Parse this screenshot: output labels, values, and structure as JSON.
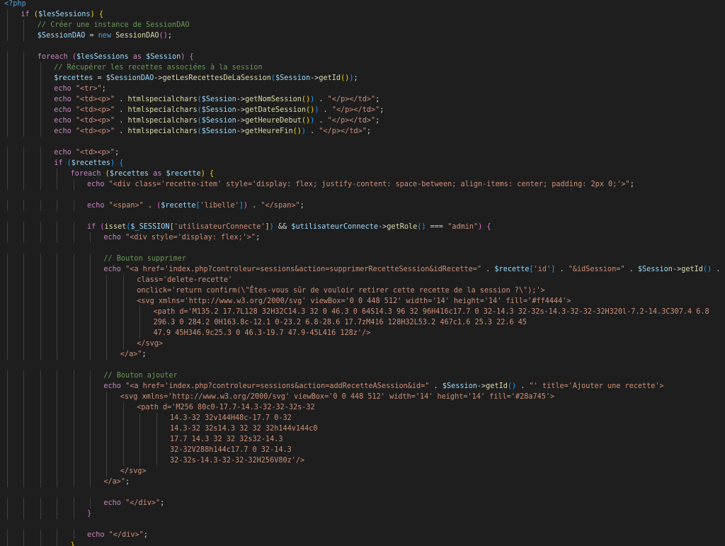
{
  "editor": {
    "language": "php",
    "lines": [
      {
        "indent": 0,
        "tokens": [
          [
            "php",
            "<?php"
          ]
        ]
      },
      {
        "indent": 1,
        "tokens": [
          [
            "kw",
            "if "
          ],
          [
            "b1",
            "("
          ],
          [
            "var",
            "$lesSessions"
          ],
          [
            "b1",
            ")"
          ],
          [
            "pn",
            " "
          ],
          [
            "b1",
            "{"
          ]
        ]
      },
      {
        "indent": 2,
        "tokens": [
          [
            "cm",
            "// Créer une instance de SessionDAO"
          ]
        ]
      },
      {
        "indent": 2,
        "tokens": [
          [
            "var",
            "$SessionDAO"
          ],
          [
            "pn",
            " = "
          ],
          [
            "st",
            "new "
          ],
          [
            "fn",
            "SessionDAO"
          ],
          [
            "b2",
            "()"
          ],
          [
            "pn",
            ";"
          ]
        ]
      },
      {
        "indent": 0,
        "tokens": []
      },
      {
        "indent": 2,
        "tokens": [
          [
            "kw",
            "foreach "
          ],
          [
            "b2",
            "("
          ],
          [
            "var",
            "$lesSessions"
          ],
          [
            "kw",
            " as "
          ],
          [
            "var",
            "$Session"
          ],
          [
            "b2",
            ")"
          ],
          [
            "pn",
            " "
          ],
          [
            "b2",
            "{"
          ]
        ]
      },
      {
        "indent": 3,
        "tokens": [
          [
            "cm",
            "// Récupérer les recettes associées à la session"
          ]
        ]
      },
      {
        "indent": 3,
        "tokens": [
          [
            "var",
            "$recettes"
          ],
          [
            "pn",
            " = "
          ],
          [
            "var",
            "$SessionDAO"
          ],
          [
            "pn",
            "->"
          ],
          [
            "fn",
            "getLesRecettesDeLaSession"
          ],
          [
            "b3",
            "("
          ],
          [
            "var",
            "$Session"
          ],
          [
            "pn",
            "->"
          ],
          [
            "fn",
            "getId"
          ],
          [
            "b1",
            "()"
          ],
          [
            "b3",
            ")"
          ],
          [
            "pn",
            ";"
          ]
        ]
      },
      {
        "indent": 3,
        "tokens": [
          [
            "kw",
            "echo "
          ],
          [
            "str",
            "\"<tr>\""
          ],
          [
            "pn",
            ";"
          ]
        ]
      },
      {
        "indent": 3,
        "tokens": [
          [
            "kw",
            "echo "
          ],
          [
            "str",
            "\"<td><p>\""
          ],
          [
            "pn",
            " . "
          ],
          [
            "fn",
            "htmlspecialchars"
          ],
          [
            "b3",
            "("
          ],
          [
            "var",
            "$Session"
          ],
          [
            "pn",
            "->"
          ],
          [
            "fn",
            "getNomSession"
          ],
          [
            "b1",
            "()"
          ],
          [
            "b3",
            ")"
          ],
          [
            "pn",
            " . "
          ],
          [
            "str",
            "\"</p></td>\""
          ],
          [
            "pn",
            ";"
          ]
        ]
      },
      {
        "indent": 3,
        "tokens": [
          [
            "kw",
            "echo "
          ],
          [
            "str",
            "\"<td><p>\""
          ],
          [
            "pn",
            " . "
          ],
          [
            "fn",
            "htmlspecialchars"
          ],
          [
            "b3",
            "("
          ],
          [
            "var",
            "$Session"
          ],
          [
            "pn",
            "->"
          ],
          [
            "fn",
            "getDateSession"
          ],
          [
            "b1",
            "()"
          ],
          [
            "b3",
            ")"
          ],
          [
            "pn",
            " . "
          ],
          [
            "str",
            "\"</p></td>\""
          ],
          [
            "pn",
            ";"
          ]
        ]
      },
      {
        "indent": 3,
        "tokens": [
          [
            "kw",
            "echo "
          ],
          [
            "str",
            "\"<td><p>\""
          ],
          [
            "pn",
            " . "
          ],
          [
            "fn",
            "htmlspecialchars"
          ],
          [
            "b3",
            "("
          ],
          [
            "var",
            "$Session"
          ],
          [
            "pn",
            "->"
          ],
          [
            "fn",
            "getHeureDebut"
          ],
          [
            "b1",
            "()"
          ],
          [
            "b3",
            ")"
          ],
          [
            "pn",
            " . "
          ],
          [
            "str",
            "\"</p></td>\""
          ],
          [
            "pn",
            ";"
          ]
        ]
      },
      {
        "indent": 3,
        "tokens": [
          [
            "kw",
            "echo "
          ],
          [
            "str",
            "\"<td><p>\""
          ],
          [
            "pn",
            " . "
          ],
          [
            "fn",
            "htmlspecialchars"
          ],
          [
            "b3",
            "("
          ],
          [
            "var",
            "$Session"
          ],
          [
            "pn",
            "->"
          ],
          [
            "fn",
            "getHeureFin"
          ],
          [
            "b1",
            "()"
          ],
          [
            "b3",
            ")"
          ],
          [
            "pn",
            " . "
          ],
          [
            "str",
            "\"</p></td>\""
          ],
          [
            "pn",
            ";"
          ]
        ]
      },
      {
        "indent": 0,
        "tokens": []
      },
      {
        "indent": 3,
        "tokens": [
          [
            "kw",
            "echo "
          ],
          [
            "str",
            "\"<td><p>\""
          ],
          [
            "pn",
            ";"
          ]
        ]
      },
      {
        "indent": 3,
        "tokens": [
          [
            "kw",
            "if "
          ],
          [
            "b3",
            "("
          ],
          [
            "var",
            "$recettes"
          ],
          [
            "b3",
            ")"
          ],
          [
            "pn",
            " "
          ],
          [
            "b3",
            "{"
          ]
        ]
      },
      {
        "indent": 4,
        "tokens": [
          [
            "kw",
            "foreach "
          ],
          [
            "b1",
            "("
          ],
          [
            "var",
            "$recettes"
          ],
          [
            "kw",
            " as "
          ],
          [
            "var",
            "$recette"
          ],
          [
            "b1",
            ")"
          ],
          [
            "pn",
            " "
          ],
          [
            "b1",
            "{"
          ]
        ]
      },
      {
        "indent": 5,
        "tokens": [
          [
            "kw",
            "echo "
          ],
          [
            "str",
            "\"<div class='recette-item' style='display: flex; justify-content: space-between; align-items: center; padding: 2px 0;'>\""
          ],
          [
            "pn",
            ";"
          ]
        ]
      },
      {
        "indent": 0,
        "tokens": []
      },
      {
        "indent": 5,
        "tokens": [
          [
            "kw",
            "echo "
          ],
          [
            "str",
            "\"<span>\""
          ],
          [
            "pn",
            " . "
          ],
          [
            "b2",
            "("
          ],
          [
            "var",
            "$recette"
          ],
          [
            "b3",
            "["
          ],
          [
            "str",
            "'libelle'"
          ],
          [
            "b3",
            "]"
          ],
          [
            "b2",
            ")"
          ],
          [
            "pn",
            " . "
          ],
          [
            "str",
            "\"</span>\""
          ],
          [
            "pn",
            ";"
          ]
        ]
      },
      {
        "indent": 0,
        "tokens": []
      },
      {
        "indent": 5,
        "tokens": [
          [
            "kw",
            "if "
          ],
          [
            "b2",
            "("
          ],
          [
            "fn",
            "isset"
          ],
          [
            "b3",
            "("
          ],
          [
            "var",
            "$_SESSION"
          ],
          [
            "b1",
            "["
          ],
          [
            "str",
            "'utilisateurConnecte'"
          ],
          [
            "b1",
            "]"
          ],
          [
            "b3",
            ")"
          ],
          [
            "pn",
            " && "
          ],
          [
            "var",
            "$utilisateurConnecte"
          ],
          [
            "pn",
            "->"
          ],
          [
            "fn",
            "getRole"
          ],
          [
            "b3",
            "()"
          ],
          [
            "pn",
            " === "
          ],
          [
            "str",
            "\"admin\""
          ],
          [
            "b2",
            ")"
          ],
          [
            "pn",
            " "
          ],
          [
            "b2",
            "{"
          ]
        ]
      },
      {
        "indent": 6,
        "tokens": [
          [
            "kw",
            "echo "
          ],
          [
            "str",
            "\"<div style='display: flex;'>\""
          ],
          [
            "pn",
            ";"
          ]
        ]
      },
      {
        "indent": 0,
        "tokens": []
      },
      {
        "indent": 6,
        "tokens": [
          [
            "cm",
            "// Bouton supprimer"
          ]
        ]
      },
      {
        "indent": 6,
        "tokens": [
          [
            "kw",
            "echo "
          ],
          [
            "str",
            "\"<a href='index.php?controleur=sessions&action=supprimerRecetteSession&idRecette=\""
          ],
          [
            "pn",
            " . "
          ],
          [
            "var",
            "$recette"
          ],
          [
            "b3",
            "["
          ],
          [
            "str",
            "'id'"
          ],
          [
            "b3",
            "]"
          ],
          [
            "pn",
            " . "
          ],
          [
            "str",
            "\"&idSession=\""
          ],
          [
            "pn",
            " . "
          ],
          [
            "var",
            "$Session"
          ],
          [
            "pn",
            "->"
          ],
          [
            "fn",
            "getId"
          ],
          [
            "b3",
            "()"
          ],
          [
            "pn",
            " . "
          ],
          [
            "str",
            "\"'"
          ]
        ]
      },
      {
        "indent": 8,
        "tokens": [
          [
            "str",
            "class='delete-recette'"
          ]
        ]
      },
      {
        "indent": 8,
        "tokens": [
          [
            "str",
            "onclick='return confirm(\\\"Êtes-vous sûr de vouloir retirer cette recette de la session ?\\\");'>"
          ]
        ]
      },
      {
        "indent": 8,
        "tokens": [
          [
            "str",
            "<svg xmlns='http://www.w3.org/2000/svg' viewBox='0 0 448 512' width='14' height='14' fill='#ff4444'>"
          ]
        ]
      },
      {
        "indent": 9,
        "tokens": [
          [
            "str",
            "<path d='M135.2 17.7L128 32H32C14.3 32 0 46.3 0 64S14.3 96 32 96H416c17.7 0 32-14.3 32-32s-14.3-32-32-32H320l-7.2-14.3C307.4 6.8"
          ]
        ]
      },
      {
        "indent": 9,
        "tokens": [
          [
            "str",
            "296.3 0 284.2 0H163.8c-12.1 0-23.2 6.8-28.6 17.7zM416 128H32L53.2 467c1.6 25.3 22.6 45"
          ]
        ]
      },
      {
        "indent": 9,
        "tokens": [
          [
            "str",
            "47.9 45H346.9c25.3 0 46.3-19.7 47.9-45L416 128z'/>"
          ]
        ]
      },
      {
        "indent": 8,
        "tokens": [
          [
            "str",
            "</svg>"
          ]
        ]
      },
      {
        "indent": 7,
        "tokens": [
          [
            "str",
            "</a>\""
          ],
          [
            "pn",
            ";"
          ]
        ]
      },
      {
        "indent": 0,
        "tokens": []
      },
      {
        "indent": 6,
        "tokens": [
          [
            "cm",
            "// Bouton ajouter"
          ]
        ]
      },
      {
        "indent": 6,
        "tokens": [
          [
            "kw",
            "echo "
          ],
          [
            "str",
            "\"<a href='index.php?controleur=sessions&action=addRecetteASession&id=\""
          ],
          [
            "pn",
            " . "
          ],
          [
            "var",
            "$Session"
          ],
          [
            "pn",
            "->"
          ],
          [
            "fn",
            "getId"
          ],
          [
            "b3",
            "()"
          ],
          [
            "pn",
            " . "
          ],
          [
            "str",
            "\"' title='Ajouter une recette'>"
          ]
        ]
      },
      {
        "indent": 7,
        "tokens": [
          [
            "str",
            "<svg xmlns='http://www.w3.org/2000/svg' viewBox='0 0 448 512' width='14' height='14' fill='#28a745'>"
          ]
        ]
      },
      {
        "indent": 8,
        "tokens": [
          [
            "str",
            "<path d='M256 80c0-17.7-14.3-32-32-32s-32"
          ]
        ]
      },
      {
        "indent": 10,
        "tokens": [
          [
            "str",
            "14.3-32 32v144H48c-17.7 0-32"
          ]
        ]
      },
      {
        "indent": 10,
        "tokens": [
          [
            "str",
            "14.3-32 32s14.3 32 32 32h144v144c0"
          ]
        ]
      },
      {
        "indent": 10,
        "tokens": [
          [
            "str",
            "17.7 14.3 32 32 32s32-14.3"
          ]
        ]
      },
      {
        "indent": 10,
        "tokens": [
          [
            "str",
            "32-32V288h144c17.7 0 32-14.3"
          ]
        ]
      },
      {
        "indent": 10,
        "tokens": [
          [
            "str",
            "32-32s-14.3-32-32-32H256V80z'/>"
          ]
        ]
      },
      {
        "indent": 7,
        "tokens": [
          [
            "str",
            "</svg>"
          ]
        ]
      },
      {
        "indent": 6,
        "tokens": [
          [
            "str",
            "</a>\""
          ],
          [
            "pn",
            ";"
          ]
        ]
      },
      {
        "indent": 0,
        "tokens": []
      },
      {
        "indent": 6,
        "tokens": [
          [
            "kw",
            "echo "
          ],
          [
            "str",
            "\"</div>\""
          ],
          [
            "pn",
            ";"
          ]
        ]
      },
      {
        "indent": 5,
        "tokens": [
          [
            "b2",
            "}"
          ]
        ]
      },
      {
        "indent": 0,
        "tokens": []
      },
      {
        "indent": 5,
        "tokens": [
          [
            "kw",
            "echo "
          ],
          [
            "str",
            "\"</div>\""
          ],
          [
            "pn",
            ";"
          ]
        ]
      },
      {
        "indent": 4,
        "tokens": [
          [
            "b1",
            "}"
          ]
        ]
      },
      {
        "indent": 3,
        "tokens": [
          [
            "b3",
            "}"
          ]
        ]
      }
    ]
  }
}
